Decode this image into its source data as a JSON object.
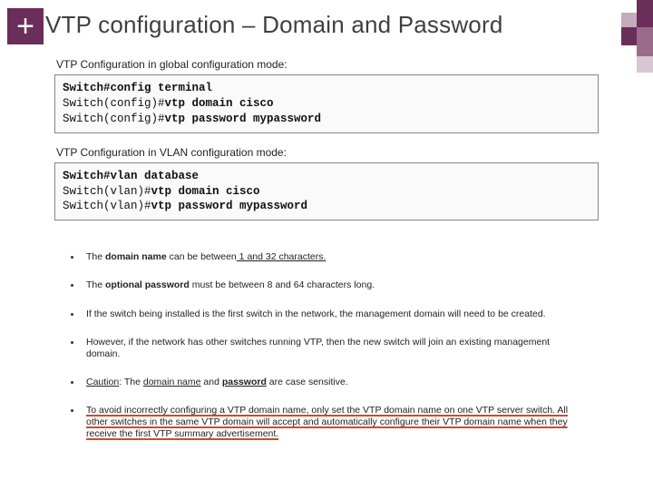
{
  "header": {
    "plus": "+",
    "title": "VTP configuration – Domain and Password"
  },
  "sections": {
    "global": {
      "label": "VTP Configuration in global configuration mode:",
      "line1": "Switch#config terminal",
      "line2a": "Switch(config)#",
      "line2b": "vtp domain cisco",
      "line3a": "Switch(config)#",
      "line3b": "vtp password mypassword"
    },
    "vlan": {
      "label": "VTP Configuration in VLAN configuration mode:",
      "line1": "Switch#vlan database",
      "line2a": "Switch(vlan)#",
      "line2b": "vtp domain cisco",
      "line3a": "Switch(vlan)#",
      "line3b": "vtp password mypassword"
    }
  },
  "bullets": {
    "b1a": "The ",
    "b1b": "domain name",
    "b1c": " can be between",
    "b1d": " 1 and 32 characters.",
    "b2a": "The ",
    "b2b": "optional password",
    "b2c": " must be between 8 and 64 characters long.",
    "b3": "If the switch being installed is the first switch in the network, the management domain will need to be created.",
    "b4": "However, if the network has other switches running VTP, then the new switch will join an existing management domain.",
    "b5a": "Caution",
    "b5b": ": The ",
    "b5c": "domain name",
    "b5d": " and ",
    "b5e": "password",
    "b5f": " are case sensitive.",
    "b6": "To avoid incorrectly configuring a VTP domain name, only set the VTP domain name on one VTP server switch. All other switches in the same VTP domain will accept and automatically configure their VTP domain name when they receive the first VTP summary advertisement."
  }
}
